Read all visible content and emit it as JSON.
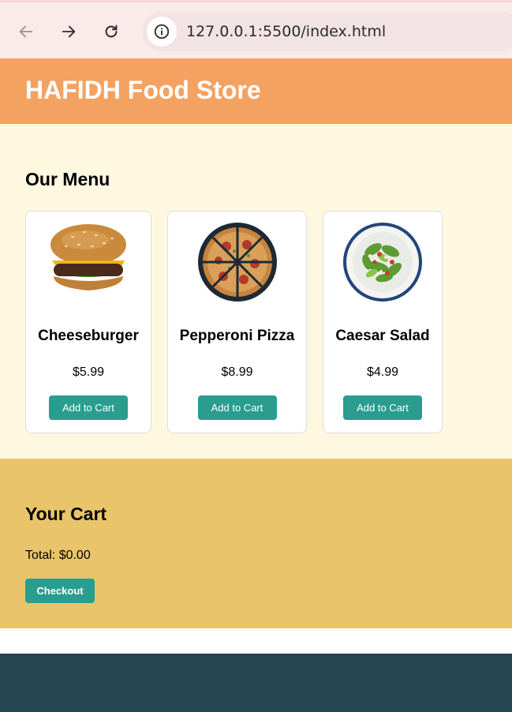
{
  "browser": {
    "url": "127.0.0.1:5500/index.html",
    "icons": {
      "back": "arrow-left-icon",
      "forward": "arrow-right-icon",
      "reload": "reload-icon",
      "info": "info-icon"
    }
  },
  "header": {
    "title": "HAFIDH Food Store"
  },
  "menu": {
    "heading": "Our Menu",
    "items": [
      {
        "name": "Cheeseburger",
        "price": "$5.99",
        "button": "Add to Cart"
      },
      {
        "name": "Pepperoni Pizza",
        "price": "$8.99",
        "button": "Add to Cart"
      },
      {
        "name": "Caesar Salad",
        "price": "$4.99",
        "button": "Add to Cart"
      }
    ]
  },
  "cart": {
    "heading": "Your Cart",
    "total": "Total: $0.00",
    "checkout": "Checkout"
  },
  "colors": {
    "header": "#f4a261",
    "menu_bg": "#fef8e1",
    "cart_bg": "#e9c46a",
    "button": "#2a9d8f",
    "footer": "#264653"
  }
}
